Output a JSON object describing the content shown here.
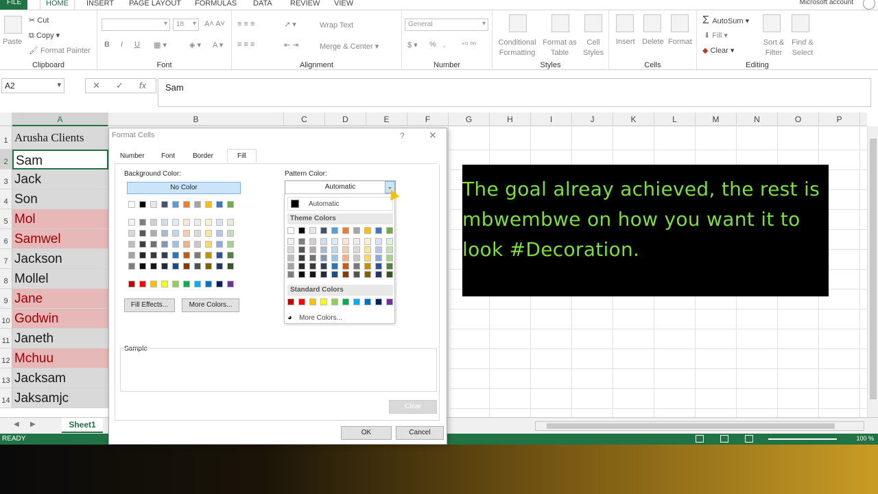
{
  "ribbon": {
    "file_tab": "FILE",
    "tabs": [
      "HOME",
      "INSERT",
      "PAGE LAYOUT",
      "FORMULAS",
      "DATA",
      "REVIEW",
      "VIEW"
    ],
    "account": "Microsoft account",
    "clipboard": {
      "label": "Clipboard",
      "paste": "Paste",
      "cut": "Cut",
      "copy": "Copy",
      "format_painter": "Format Painter"
    },
    "font": {
      "label": "Font",
      "size": "18",
      "bold": "B",
      "italic": "I",
      "underline": "U"
    },
    "alignment": {
      "label": "Alignment",
      "wrap": "Wrap Text",
      "merge": "Merge & Center"
    },
    "number": {
      "label": "Number",
      "format": "General",
      "percent": "%"
    },
    "styles": {
      "label": "Styles",
      "conditional": "Conditional Formatting",
      "format_as_table": "Format as Table",
      "cell_styles": "Cell Styles"
    },
    "cells": {
      "label": "Cells",
      "insert": "Insert",
      "delete": "Delete",
      "format": "Format"
    },
    "editing": {
      "label": "Editing",
      "autosum": "AutoSum",
      "fill": "Fill",
      "clear": "Clear",
      "sort": "Sort & Filter",
      "find": "Find & Select"
    }
  },
  "formula_bar": {
    "name_box": "A2",
    "fx": "fx",
    "value": "Sam"
  },
  "columns": [
    "A",
    "B",
    "C",
    "D",
    "E",
    "F",
    "G",
    "H",
    "I",
    "J",
    "K",
    "L",
    "M",
    "N",
    "O",
    "P"
  ],
  "rows": [
    {
      "num": "1",
      "value": "Arusha Clients",
      "style": "hdr"
    },
    {
      "num": "2",
      "value": "Sam",
      "style": "white"
    },
    {
      "num": "3",
      "value": "Jack",
      "style": "gray"
    },
    {
      "num": "4",
      "value": "Son",
      "style": "gray"
    },
    {
      "num": "5",
      "value": "Mol",
      "style": "pink"
    },
    {
      "num": "6",
      "value": "Samwel",
      "style": "pink"
    },
    {
      "num": "7",
      "value": "Jackson",
      "style": "gray"
    },
    {
      "num": "8",
      "value": "Mollel",
      "style": "gray"
    },
    {
      "num": "9",
      "value": "Jane",
      "style": "pink"
    },
    {
      "num": "10",
      "value": "Godwin",
      "style": "pink"
    },
    {
      "num": "11",
      "value": "Janeth",
      "style": "gray"
    },
    {
      "num": "12",
      "value": "Mchuu",
      "style": "pink"
    },
    {
      "num": "13",
      "value": "Jacksam",
      "style": "gray"
    },
    {
      "num": "14",
      "value": "Jaksamjc",
      "style": "gray"
    }
  ],
  "sheet": {
    "tab": "Sheet1",
    "status": "READY",
    "zoom": "100 %"
  },
  "dialog": {
    "title": "Format Cells",
    "help": "?",
    "tabs": [
      "Number",
      "Font",
      "Border",
      "Fill"
    ],
    "background_color_label": "Background Color:",
    "no_color": "No Color",
    "fill_effects": "Fill Effects...",
    "more_colors": "More Colors...",
    "pattern_color_label": "Pattern Color:",
    "pattern_color_value": "Automatic",
    "sample_label": "Sample",
    "clear": "Clear",
    "ok": "OK",
    "cancel": "Cancel"
  },
  "dropdown": {
    "automatic": "Automatic",
    "theme_colors": "Theme Colors",
    "standard_colors": "Standard Colors",
    "more_colors": "More Colors..."
  },
  "palette": {
    "theme_top": [
      "#ffffff",
      "#000000",
      "#e7e6e6",
      "#44546a",
      "#5b9bd5",
      "#ed7d31",
      "#a5a5a5",
      "#ffc000",
      "#4472c4",
      "#70ad47"
    ],
    "theme_shades": [
      [
        "#f2f2f2",
        "#7f7f7f",
        "#d0cece",
        "#d6dce4",
        "#deebf6",
        "#fbe5d5",
        "#ededed",
        "#fff2cc",
        "#dae3f3",
        "#e2efd9"
      ],
      [
        "#d8d8d8",
        "#595959",
        "#aeaaaa",
        "#adb9ca",
        "#bdd7ee",
        "#f7cbac",
        "#dbdbdb",
        "#fee599",
        "#b4c6e7",
        "#c5e0b3"
      ],
      [
        "#bfbfbf",
        "#3f3f3f",
        "#757070",
        "#8496b0",
        "#9cc3e5",
        "#f4b183",
        "#c9c9c9",
        "#ffd965",
        "#8eaadb",
        "#a8d08d"
      ],
      [
        "#a5a5a5",
        "#262626",
        "#3a3838",
        "#323f4f",
        "#2e75b5",
        "#c55a11",
        "#7b7b7b",
        "#bf9000",
        "#2f5496",
        "#538135"
      ],
      [
        "#7f7f7f",
        "#0c0c0c",
        "#171616",
        "#222a35",
        "#1e4e79",
        "#833c0b",
        "#525252",
        "#7f6000",
        "#1f3864",
        "#375623"
      ]
    ],
    "standard": [
      "#c00000",
      "#ff0000",
      "#ffc000",
      "#ffff00",
      "#92d050",
      "#00b050",
      "#00b0f0",
      "#0070c0",
      "#002060",
      "#7030a0"
    ]
  },
  "annotation": {
    "text": "The goal alreay achieved, the rest is mbwembwe on how you want it to look #Decoration.",
    "color": "#7dde3a"
  },
  "icons": [
    "paste-icon",
    "cut-icon",
    "copy-icon",
    "format-painter-icon",
    "autosum-icon",
    "clear-icon",
    "chevron-down-icon",
    "close-icon"
  ]
}
